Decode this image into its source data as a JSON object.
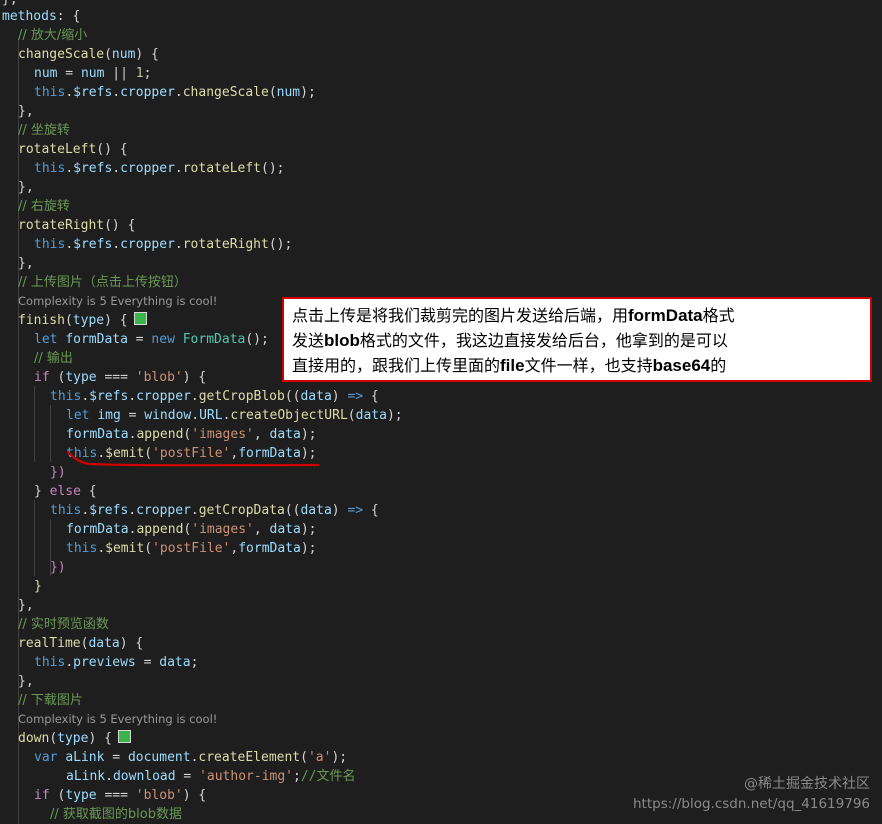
{
  "code_lines": [
    "},",
    "methods: {",
    "// 放大/缩小",
    "changeScale(num) {",
    "num = num || 1;",
    "this.$refs.cropper.changeScale(num);",
    "},",
    "// 坐旋转",
    "rotateLeft() {",
    "this.$refs.cropper.rotateLeft();",
    "},",
    "// 右旋转",
    "rotateRight() {",
    "this.$refs.cropper.rotateRight();",
    "},",
    "// 上传图片（点击上传按钮）",
    "finish(type) {",
    "let formData = new FormData();",
    "// 输出",
    "if (type === 'blob') {",
    "this.$refs.cropper.getCropBlob((data) => {",
    "let img = window.URL.createObjectURL(data);",
    "formData.append('images', data);",
    "this.$emit('postFile',formData);",
    "})",
    "} else {",
    "this.$refs.cropper.getCropData((data) => {",
    "formData.append('images', data);",
    "this.$emit('postFile',formData);",
    "})",
    "}",
    "},",
    "// 实时预览函数",
    "realTime(data) {",
    "this.previews = data;",
    "},",
    "// 下载图片",
    "down(type) {",
    "var aLink = document.createElement('a');",
    "aLink.download = 'author-img';//文件名",
    "if (type === 'blob') {",
    "// 获取截图的blob数据"
  ],
  "codelens": {
    "finish": "Complexity is 5 Everything is cool!",
    "down": "Complexity is 5 Everything is cool!"
  },
  "annotation": {
    "line1": {
      "a": "点击上传是将我们裁剪完的图片发送给后端，用",
      "b": "formData",
      "c": "格式"
    },
    "line2": {
      "a": "发送",
      "b": "blob",
      "c": "格式的文件，我这边直接发给后台，他拿到的是可以"
    },
    "line3": {
      "a": "直接用的，跟我们上传里面的",
      "b": "file",
      "c": "文件一样，也支持",
      "d": "base64",
      "e": "的"
    }
  },
  "watermark": {
    "site": "@稀土掘金技术社区",
    "url": "https://blog.csdn.net/qq_41619796"
  },
  "colors": {
    "background": "#1e1e1e",
    "keyword": "#569cd6",
    "control": "#c586c0",
    "function": "#dcdcaa",
    "variable": "#9cdcfe",
    "string": "#ce9178",
    "number": "#b5cea8",
    "class": "#4ec9b0",
    "comment": "#6a9955",
    "annotation_border": "#d00000",
    "underline": "#d00000",
    "status_square": "#3bb54a"
  }
}
